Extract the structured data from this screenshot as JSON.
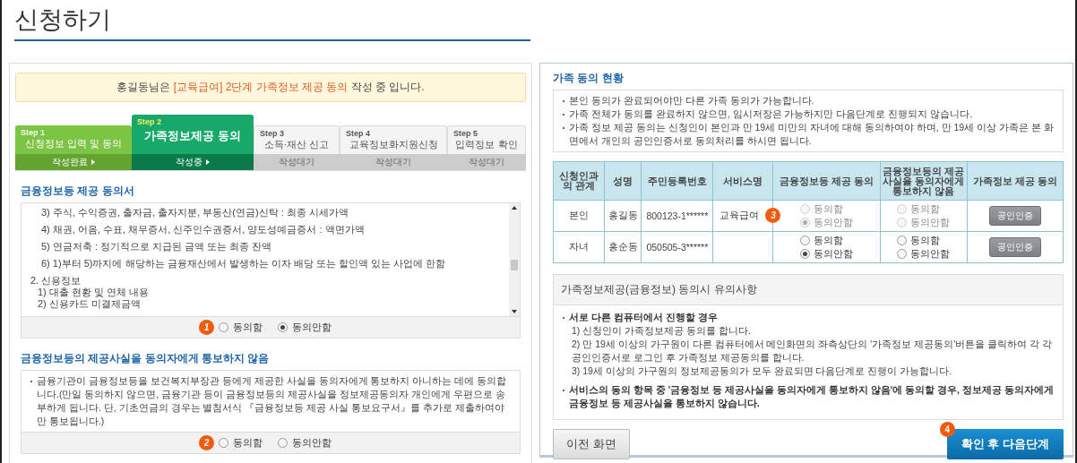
{
  "page_title": "신청하기",
  "banner": {
    "text": "홍길동님은 **[교육급여] 2단계 가족정보 제공 동의** 작성 중 입니다."
  },
  "steps": [
    {
      "label": "Step 1",
      "title": "신청정보 입력 및 동의",
      "status": "작성완료",
      "completed": true,
      "selected": false
    },
    {
      "label": "Step 2",
      "title": "가족정보제공 동의",
      "status": "작성중",
      "selected": true
    },
    {
      "label": "Step 3",
      "title": "소득·재산 신고",
      "status": "작성대기",
      "completed": false,
      "selected": false
    },
    {
      "label": "Step 4",
      "title": "교육정보화지원신청",
      "status": "작성대기",
      "completed": false,
      "selected": false
    },
    {
      "label": "Step 5",
      "title": "입력정보 확인",
      "status": "작성대기",
      "completed": false,
      "selected": false
    }
  ],
  "consent_form": {
    "title": "금융정보등 제공 동의서",
    "badge": "1",
    "lines": [
      {
        "text": "3) 주식, 수익증권, 출자금, 출자지분, 부동산(연금)신탁 : 최종 시세가액",
        "kind": "item"
      },
      {
        "text": "4) 채권, 어음, 수표, 채무증서, 신주인수권증서, 양도성예금증서 : 액면가액",
        "kind": "item"
      },
      {
        "text": "5) 연금저축 : 정기적으로 지급된 금액 또는 최종 잔액",
        "kind": "item"
      },
      {
        "text": "6) 1)부터 5)까지에 해당하는 금융재산에서 발생하는 이자 배당 또는 할인액  있는 사업에 한함",
        "kind": "item"
      },
      {
        "text": "2. 신용정보",
        "kind": "heading"
      },
      {
        "text": "1) 대출 현황 및 연체 내용",
        "kind": "sub"
      },
      {
        "text": "2) 신용카드 미결제금액",
        "kind": "sub"
      }
    ],
    "options": [
      {
        "label": "동의함",
        "selected": false
      },
      {
        "label": "동의안함",
        "selected": true
      }
    ]
  },
  "notify_form": {
    "title": "금융정보등의 제공사실을 동의자에게 통보하지 않음",
    "badge": "2",
    "text": "금융기관이 금융정보등을 보건복지부장관 등에게 제공한 사실을 동의자에게 통보하지 아니하는 데에 동의합니다.(만일 동의하지 않으면, 금융기관 등이 금융정보등의 제공사실을 정보제공동의자 개인에게 우편으로 송부하게 됩니다. 단, 기초연금의 경우는 별첨서식 『금융정보등 제공 사실 통보요구서』를 추가로 제출하여야만 통보됩니다.)",
    "options": [
      {
        "label": "동의함",
        "selected": false
      },
      {
        "label": "동의안함",
        "selected": false
      }
    ]
  },
  "family": {
    "title": "가족 동의 현황",
    "notes": [
      "본인 동의가 완료되어야만 다른 가족 동의가 가능합니다.",
      "가족 전체가 동의를 완료하지 않으면, 임시저장은 가능하지만 다음단계로 진행되지 않습니다.",
      "가족 정보 제공 동의는 신청인이 본인과 만 19세 미만의 자녀에 대해 동의하여야 하며, 만 19세 이상 가족은 본 화면에서 개인의 공인인증서로 동의처리를 하시면 됩니다."
    ],
    "columns": [
      "신청인과의 관계",
      "성명",
      "주민등록번호",
      "서비스명",
      "금융정보등 제공 동의",
      "금융정보등의 제공사실을 동의자에게 통보하지 않음",
      "가족정보 제공 동의"
    ],
    "rows": [
      {
        "relation": "본인",
        "name": "홍길동",
        "rrn": "800123-1******",
        "service": "교육급여",
        "badge": "3",
        "financial": {
          "disabled": true,
          "options": [
            {
              "label": "동의함",
              "selected": false
            },
            {
              "label": "동의안함",
              "selected": true
            }
          ]
        },
        "notify": {
          "disabled": true,
          "options": [
            {
              "label": "동의함",
              "selected": false
            },
            {
              "label": "동의안함",
              "selected": false
            }
          ]
        },
        "action": "공인인증"
      },
      {
        "relation": "자녀",
        "name": "홍순동",
        "rrn": "050505-3******",
        "financial": {
          "disabled": false,
          "options": [
            {
              "label": "동의함",
              "selected": false
            },
            {
              "label": "동의안함",
              "selected": true
            }
          ]
        },
        "notify": {
          "disabled": false,
          "options": [
            {
              "label": "동의함",
              "selected": false
            },
            {
              "label": "동의안함",
              "selected": false
            }
          ]
        },
        "action": "공인인증"
      }
    ]
  },
  "cautions": {
    "title": "가족정보제공(금융정보) 동의시 유의사항",
    "items": [
      {
        "heading": "서로 다른 컴퓨터에서 진행할 경우",
        "lines": [
          "1) 신청인이 가족정보제공 동의를 합니다.",
          "2) 만 19세 이상의 가구원이 다른 컴퓨터에서 메인화면의 좌측상단의 '가족정보 제공동의'버튼을 클릭하여 각 각 공인인증서로 로그인 후 가족정보 제공동의를 합니다.",
          "3) 19세 이상의 가구원의 정보제공동의가 모두 완료되면 다음단계로 진행이 가능합니다."
        ]
      },
      {
        "heading": "서비스의 동의 항목 중 '금융정보 등 제공사실을 동의자에게 통보하지 않음'에 동의할 경우, 정보제공 동의자에게 금융정보 등 제공사실을 통보하지 않습니다."
      }
    ]
  },
  "buttons": {
    "prev": "이전 화면",
    "next": "확인 후 다음단계",
    "next_badge": "4"
  }
}
